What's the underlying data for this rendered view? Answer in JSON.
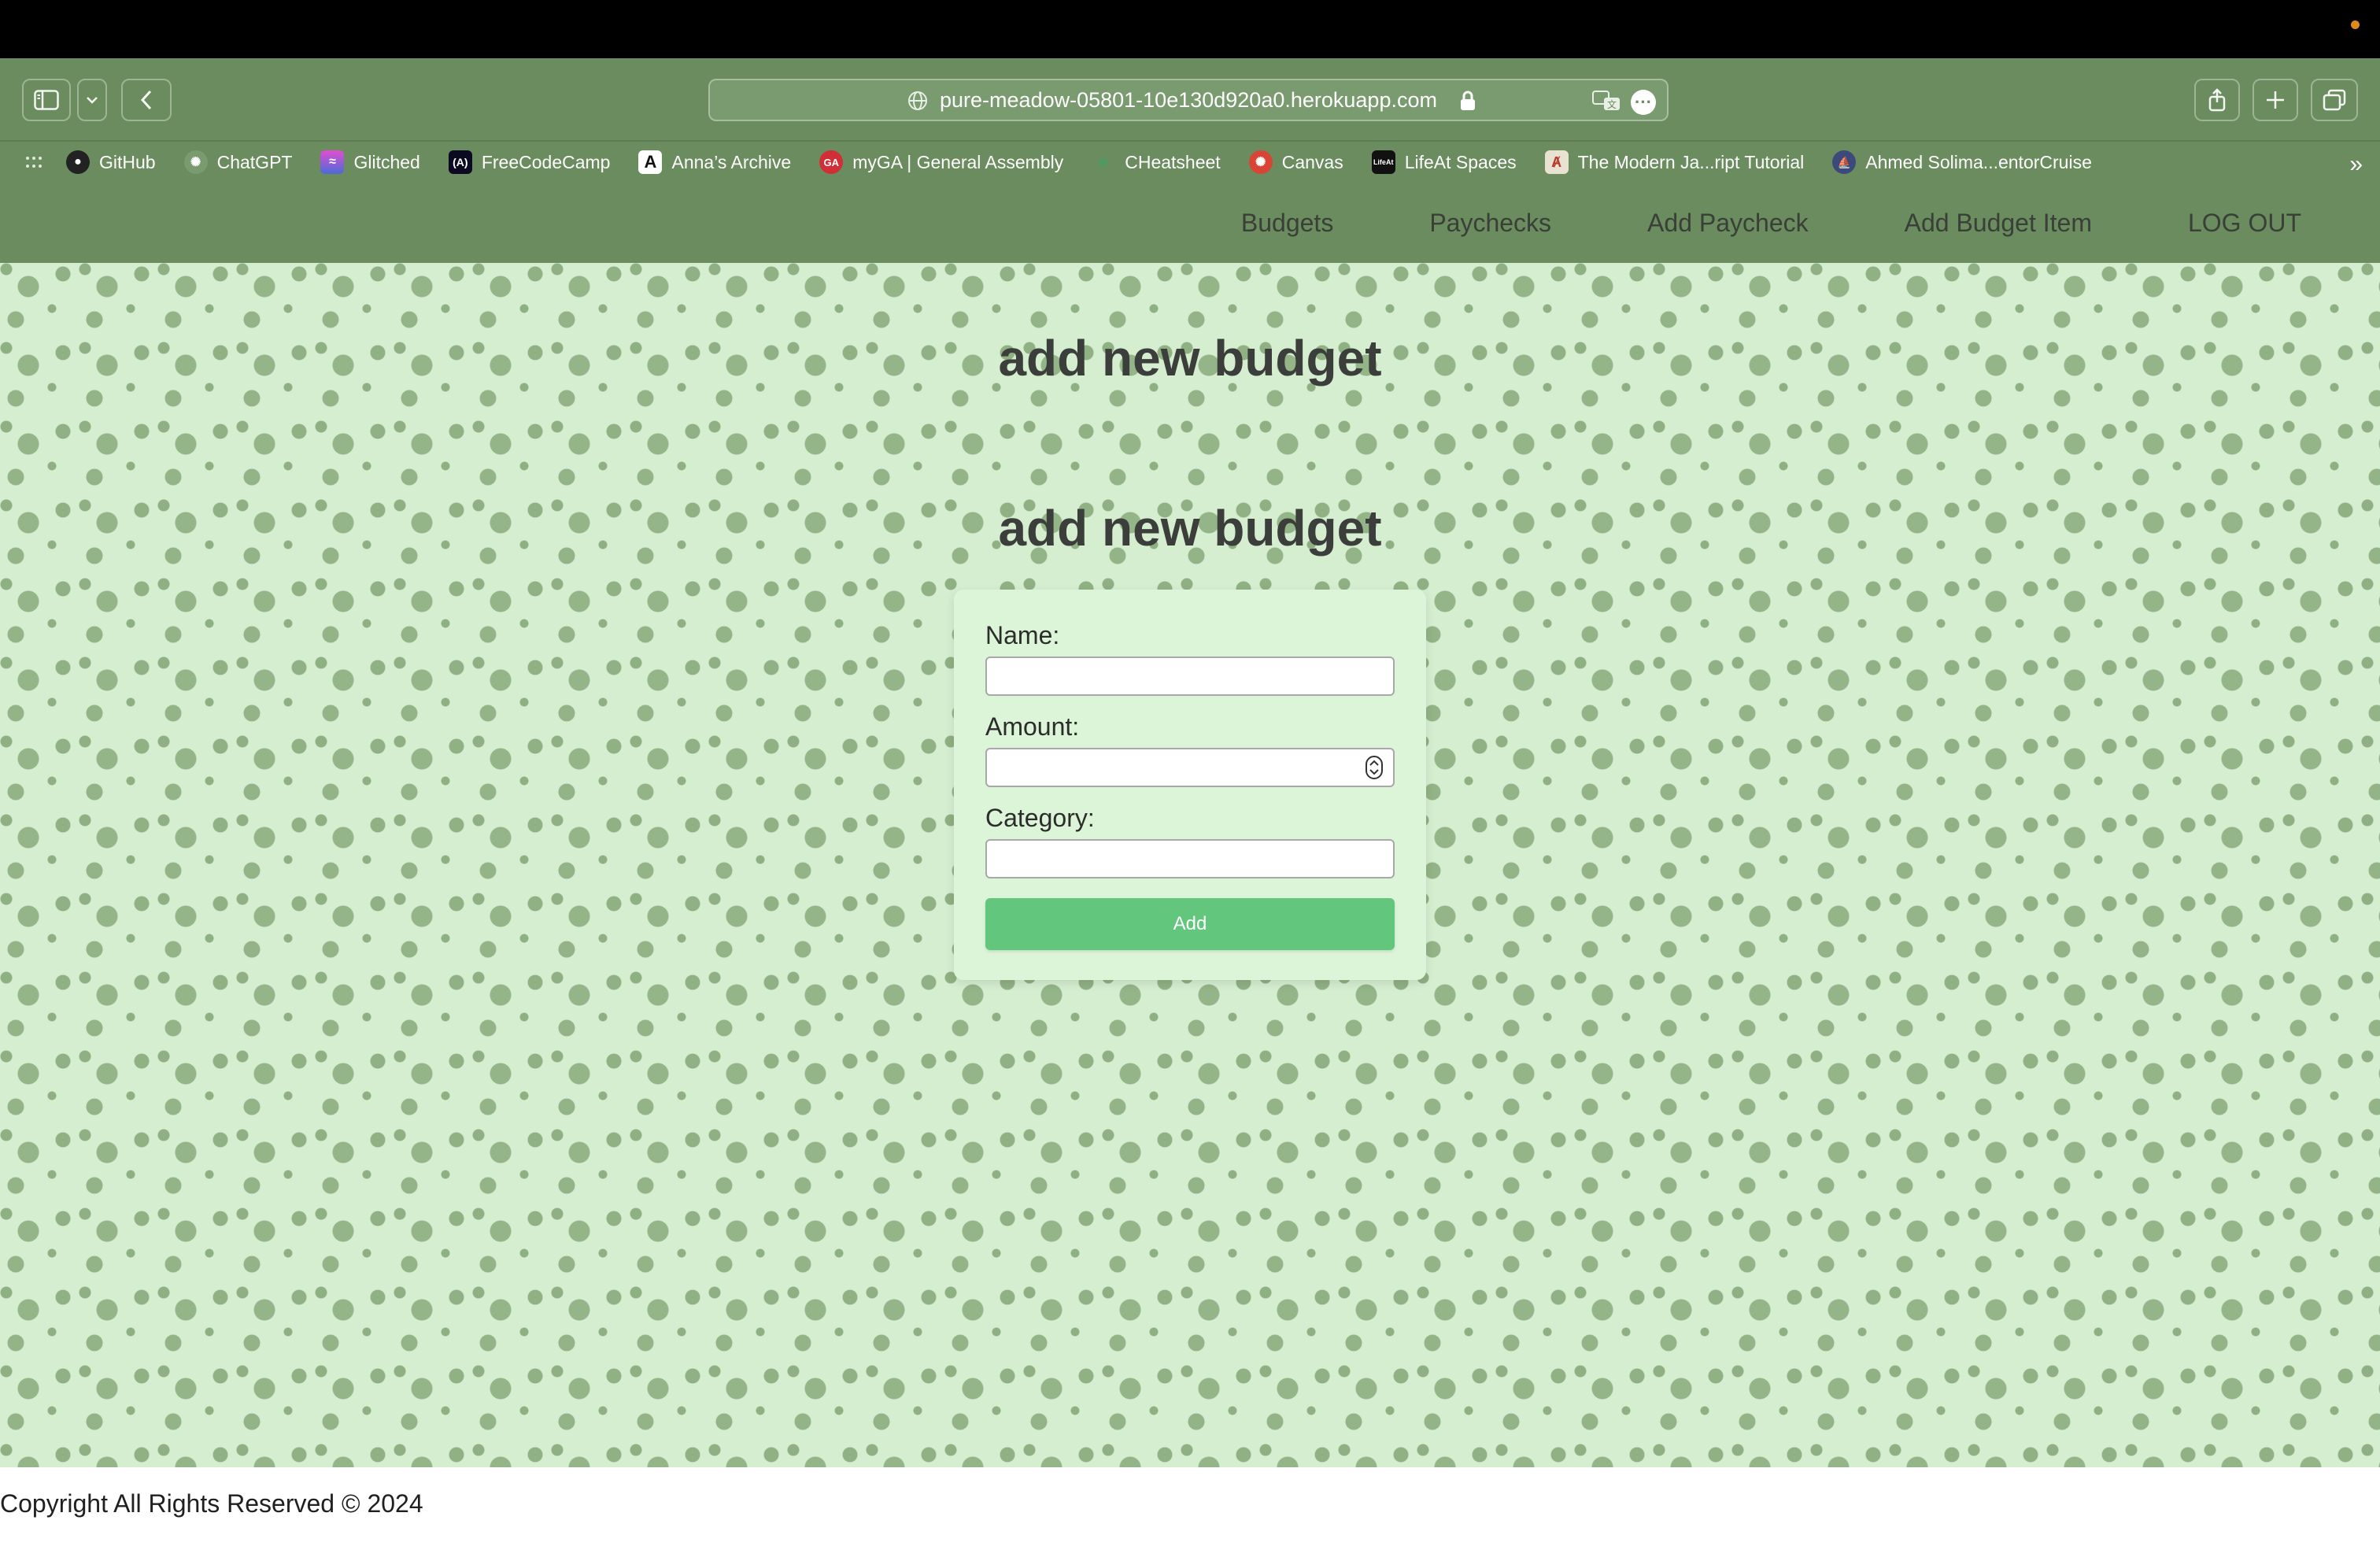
{
  "browser": {
    "url": "pure-meadow-05801-10e130d920a0.herokuapp.com",
    "accent_color": "#6a8c5e"
  },
  "bookmarks": [
    {
      "label": "GitHub",
      "icon": "github-icon",
      "color": "#222222"
    },
    {
      "label": "ChatGPT",
      "icon": "chatgpt-icon",
      "color": "#7a9a6f"
    },
    {
      "label": "Glitched",
      "icon": "glitched-icon",
      "color": "#c04bd8"
    },
    {
      "label": "FreeCodeCamp",
      "icon": "freecodecamp-icon",
      "color": "#0a0a23"
    },
    {
      "label": "Anna’s Archive",
      "icon": "annas-archive-icon",
      "color": "#111111"
    },
    {
      "label": "myGA | General Assembly",
      "icon": "ga-icon",
      "color": "#d22e36"
    },
    {
      "label": "CHeatsheet",
      "icon": "cheatsheet-icon",
      "color": "#4f9a62"
    },
    {
      "label": "Canvas",
      "icon": "canvas-icon",
      "color": "#d84536"
    },
    {
      "label": "LifeAt Spaces",
      "icon": "lifeat-icon",
      "color": "#111111"
    },
    {
      "label": "The Modern Ja...ript Tutorial",
      "icon": "javascript-info-icon",
      "color": "#e9e2d0"
    },
    {
      "label": "Ahmed Solima...entorCruise",
      "icon": "mentorcruise-icon",
      "color": "#3b4a7a"
    }
  ],
  "nav": {
    "links": [
      "Budgets",
      "Paychecks",
      "Add Paycheck",
      "Add Budget Item",
      "LOG OUT"
    ]
  },
  "page": {
    "heading_1": "add new budget",
    "heading_2": "add new budget"
  },
  "form": {
    "name_label": "Name:",
    "name_value": "",
    "amount_label": "Amount:",
    "amount_value": "",
    "category_label": "Category:",
    "category_value": "",
    "submit_label": "Add",
    "submit_color": "#62c77c"
  },
  "footer": {
    "text": "Copyright All Rights Reserved © 2024"
  }
}
